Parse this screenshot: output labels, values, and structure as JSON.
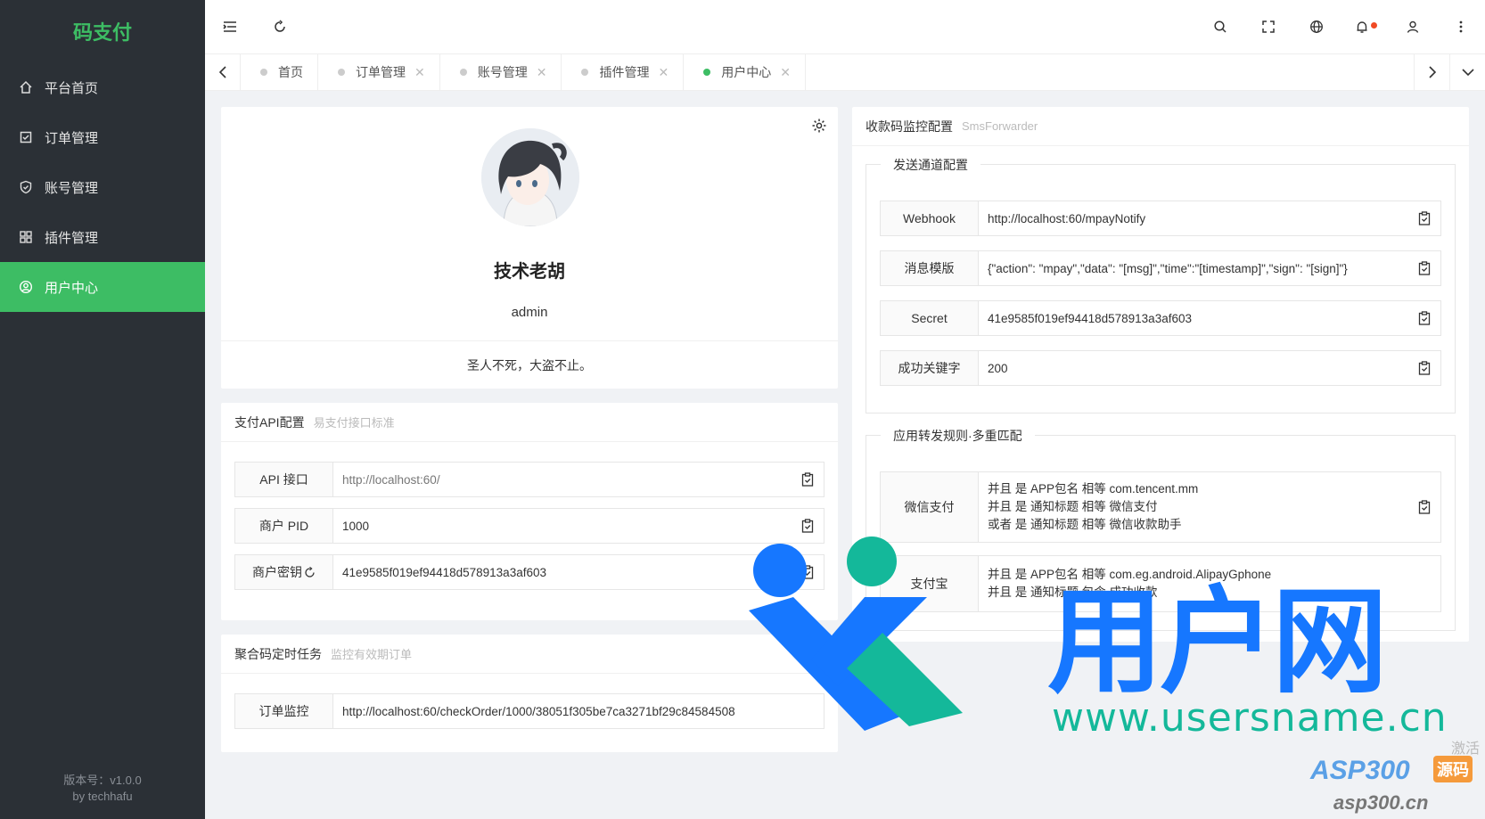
{
  "sidebar": {
    "brand": "码支付",
    "items": [
      {
        "label": "平台首页",
        "icon": "home-icon"
      },
      {
        "label": "订单管理",
        "icon": "order-icon"
      },
      {
        "label": "账号管理",
        "icon": "shield-icon"
      },
      {
        "label": "插件管理",
        "icon": "grid-icon"
      },
      {
        "label": "用户中心",
        "icon": "user-circle-icon",
        "active": true
      }
    ],
    "version": "版本号：v1.0.0",
    "author": "by techhafu"
  },
  "tabs": [
    {
      "label": "首页",
      "closable": false
    },
    {
      "label": "订单管理",
      "closable": true
    },
    {
      "label": "账号管理",
      "closable": true
    },
    {
      "label": "插件管理",
      "closable": true
    },
    {
      "label": "用户中心",
      "closable": true,
      "active": true
    }
  ],
  "profile": {
    "name": "技术老胡",
    "username": "admin",
    "motto": "圣人不死，大盗不止。"
  },
  "api_config": {
    "title": "支付API配置",
    "subtitle": "易支付接口标准",
    "fields": [
      {
        "label": "API 接口",
        "value": "http://localhost:60/"
      },
      {
        "label": "商户 PID",
        "value": "1000"
      },
      {
        "label": "商户密钥",
        "value": "41e9585f019ef94418d578913a3af603"
      }
    ]
  },
  "cron": {
    "title": "聚合码定时任务",
    "subtitle": "监控有效期订单",
    "field_label": "订单监控",
    "field_value": "http://localhost:60/checkOrder/1000/38051f305be7ca3271bf29c84584508"
  },
  "sms": {
    "title": "收款码监控配置",
    "subtitle": "SmsForwarder",
    "channel_legend": "发送通道配置",
    "channel_fields": [
      {
        "label": "Webhook",
        "value": "http://localhost:60/mpayNotify"
      },
      {
        "label": "消息模版",
        "value": "{\"action\": \"mpay\",\"data\": \"[msg]\",\"time\":\"[timestamp]\",\"sign\": \"[sign]\"}"
      },
      {
        "label": "Secret",
        "value": "41e9585f019ef94418d578913a3af603"
      },
      {
        "label": "成功关键字",
        "value": "200"
      }
    ],
    "rules_legend": "应用转发规则·多重匹配",
    "rules": [
      {
        "label": "微信支付",
        "lines": [
          "并且 是 APP包名 相等 com.tencent.mm",
          "并且 是 通知标题 相等 微信支付",
          " 或者 是 通知标题 相等 微信收款助手"
        ]
      },
      {
        "label": "支付宝",
        "lines": [
          "并且 是 APP包名 相等 com.eg.android.AlipayGphone",
          "并且 是 通知标题 包含 成功收款"
        ]
      }
    ]
  },
  "watermark": {
    "brand": "用户网",
    "url": "www.usersname.cn",
    "asp": "ASP300",
    "asp_tag": "源码",
    "asp_url": "asp300.cn",
    "activate": "激活"
  }
}
